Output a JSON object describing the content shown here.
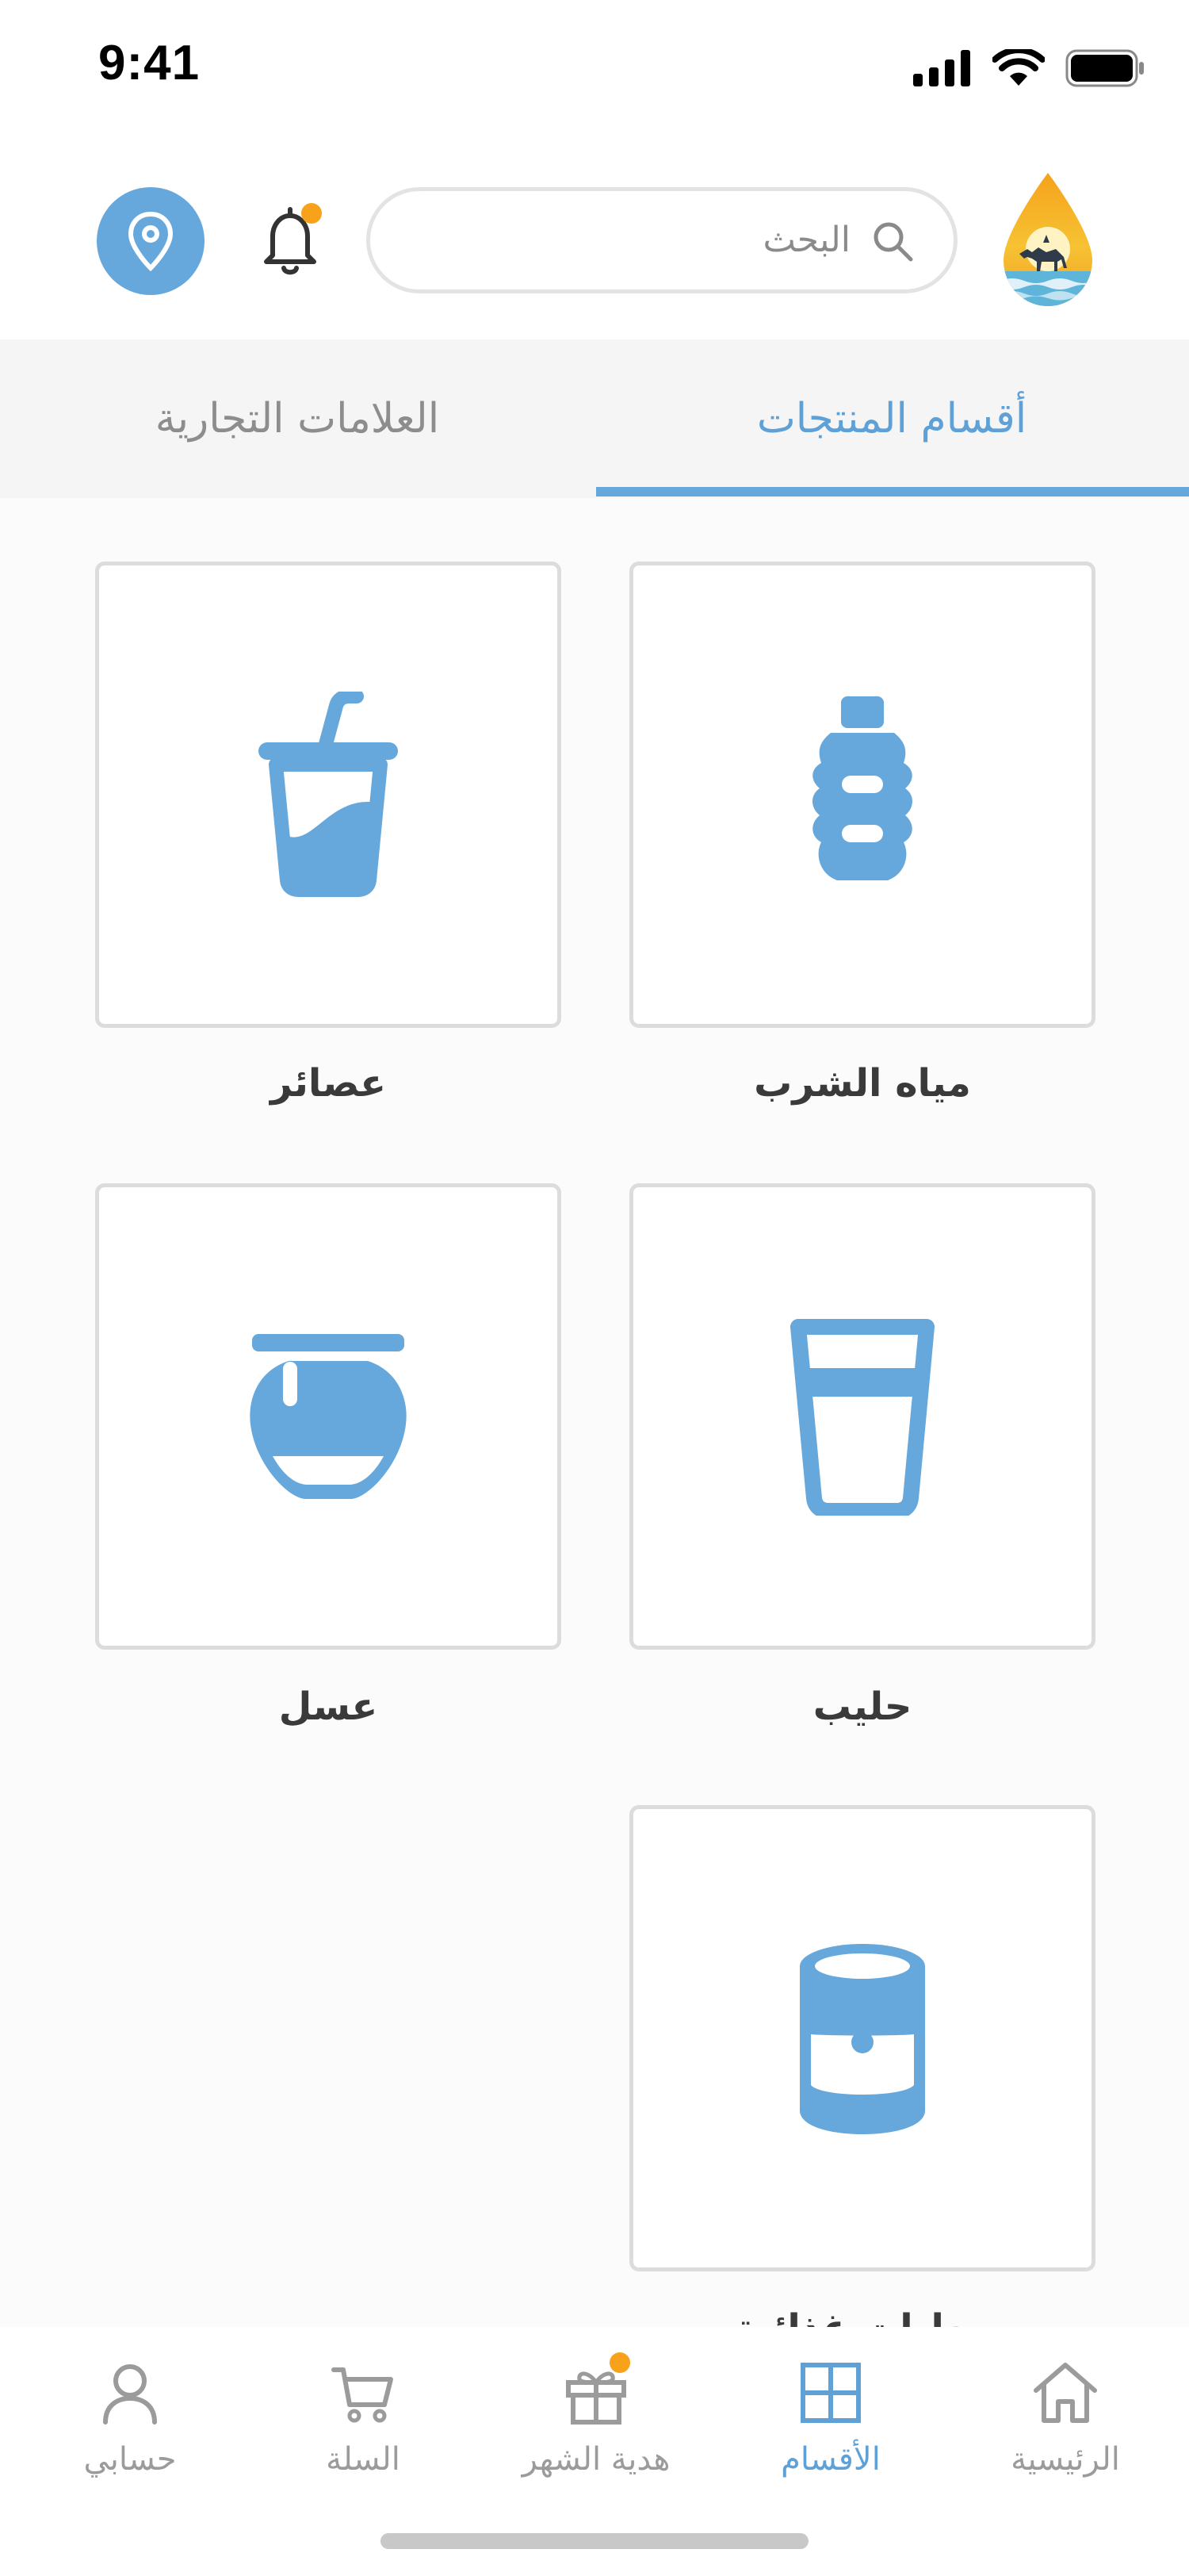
{
  "status_bar": {
    "time": "9:41"
  },
  "header": {
    "search_placeholder": "البحث"
  },
  "tabs": {
    "products": "أقسام المنتجات",
    "brands": "العلامات التجارية"
  },
  "categories": [
    {
      "label": "مياه الشرب",
      "icon": "water-bottle-icon"
    },
    {
      "label": "عصائر",
      "icon": "juice-cup-icon"
    },
    {
      "label": "حليب",
      "icon": "milk-glass-icon"
    },
    {
      "label": "عسل",
      "icon": "honey-jar-icon"
    },
    {
      "label": "معلبات غذائية",
      "icon": "canned-food-icon"
    }
  ],
  "bottom_nav": [
    {
      "label": "الرئيسية",
      "icon": "home-icon",
      "active": false
    },
    {
      "label": "الأقسام",
      "icon": "grid-icon",
      "active": true
    },
    {
      "label": "هدية الشهر",
      "icon": "gift-icon",
      "active": false
    },
    {
      "label": "السلة",
      "icon": "cart-icon",
      "active": false
    },
    {
      "label": "حسابي",
      "icon": "user-icon",
      "active": false
    }
  ],
  "colors": {
    "accent": "#67a8dc",
    "badge": "#f7a21a",
    "inactive": "#9b9b9b"
  }
}
